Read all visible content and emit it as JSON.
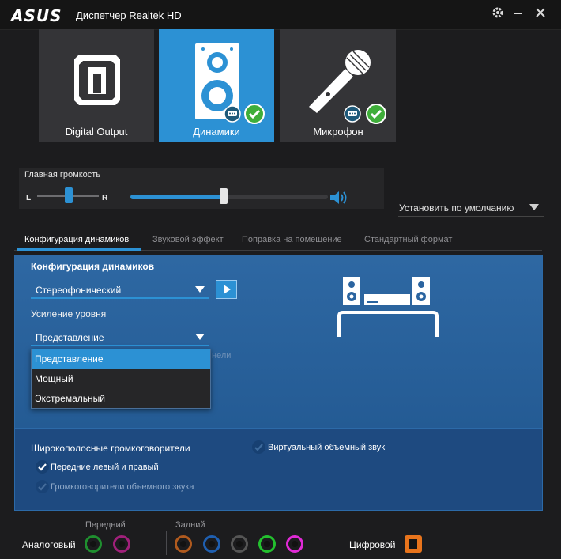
{
  "window": {
    "logo": "ASUS",
    "title": "Диспетчер Realtek HD",
    "controls": {
      "settings_icon": "gear-icon",
      "minimize_icon": "minimize-icon",
      "close_icon": "close-icon"
    }
  },
  "devices": [
    {
      "label": "Digital Output",
      "icon": "digital-output-icon",
      "active": false
    },
    {
      "label": "Динамики",
      "icon": "speaker-icon",
      "active": true
    },
    {
      "label": "Микрофон",
      "icon": "microphone-icon",
      "active": false
    }
  ],
  "volume": {
    "title": "Главная громкость",
    "left_label": "L",
    "right_label": "R",
    "balance_percent": 50,
    "level_percent": 48,
    "icon": "speaker-volume-icon"
  },
  "set_default": {
    "label": "Установить по умолчанию"
  },
  "tabs": [
    {
      "label": "Конфигурация динамиков",
      "active": true
    },
    {
      "label": "Звуковой эффект",
      "active": false
    },
    {
      "label": "Поправка на помещение",
      "active": false
    },
    {
      "label": "Стандартный формат",
      "active": false
    }
  ],
  "config": {
    "section_title": "Конфигурация динамиков",
    "config_value": "Стереофонический",
    "gain_label": "Усиление уровня",
    "gain_value": "Представление",
    "hidden_text": "нели",
    "gain_options": [
      "Представление",
      "Мощный",
      "Экстремальный"
    ],
    "selected_option_index": 0
  },
  "fullrange": {
    "title": "Широкополосные громкоговорители",
    "front_lr": {
      "label": "Передние левый и правый",
      "checked": true,
      "enabled": true
    },
    "surround": {
      "label": "Громкоговорители объемного звука",
      "checked": false,
      "enabled": false
    },
    "virtual_surround": {
      "label": "Виртуальный объемный звук",
      "checked": false,
      "enabled": true
    }
  },
  "jacks": {
    "front_label": "Передний",
    "rear_label": "Задний",
    "analog_label": "Аналоговый",
    "digital_label": "Цифровой",
    "front_colors": [
      "#1f8f2f",
      "#a0207a"
    ],
    "rear_colors": [
      "#b05a1e",
      "#1f5fb0",
      "#2a2a2a",
      "#23c02e",
      "#e02ad6"
    ],
    "digital_color": "#e8741c"
  },
  "colors": {
    "accent": "#2c91d4",
    "panel": "#2a64a0"
  }
}
